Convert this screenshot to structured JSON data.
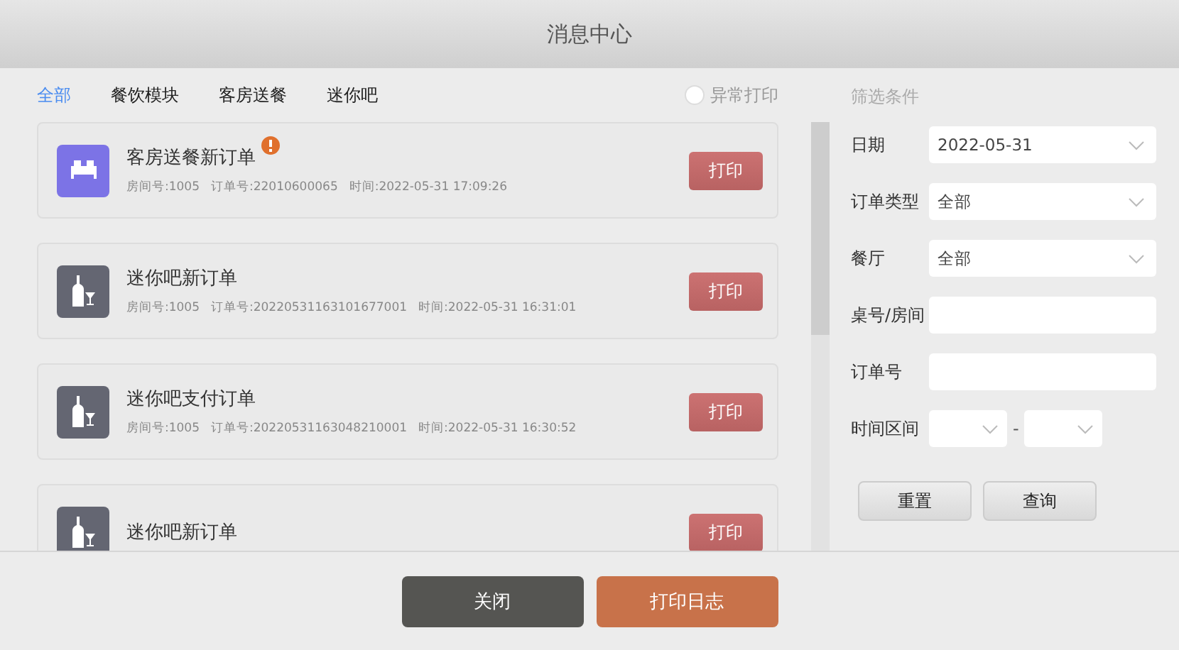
{
  "window": {
    "title": "消息中心"
  },
  "tabs": [
    {
      "label": "全部",
      "selected": true
    },
    {
      "label": "餐饮模块",
      "selected": false
    },
    {
      "label": "客房送餐",
      "selected": false
    },
    {
      "label": "迷你吧",
      "selected": false
    }
  ],
  "abnormal_print": {
    "label": "异常打印",
    "checked": false
  },
  "messages": [
    {
      "kind": "room_service",
      "title": "客房送餐新订单",
      "alert": true,
      "room": "房间号:1005",
      "order": "订单号:22010600065",
      "time": "时间:2022-05-31  17:09:26",
      "button": "打印"
    },
    {
      "kind": "minibar",
      "title": "迷你吧新订单",
      "alert": false,
      "room": "房间号:1005",
      "order": "订单号:20220531163101677001",
      "time": "时间:2022-05-31  16:31:01",
      "button": "打印"
    },
    {
      "kind": "minibar",
      "title": "迷你吧支付订单",
      "alert": false,
      "room": "房间号:1005",
      "order": "订单号:20220531163048210001",
      "time": "时间:2022-05-31  16:30:52",
      "button": "打印"
    },
    {
      "kind": "minibar",
      "title": "迷你吧新订单",
      "alert": false,
      "button": "打印"
    }
  ],
  "filter": {
    "title": "筛选条件",
    "fields": [
      {
        "kind": "select",
        "label": "日期",
        "value": "2022-05-31"
      },
      {
        "kind": "select",
        "label": "订单类型",
        "value": "全部"
      },
      {
        "kind": "select",
        "label": "餐厅",
        "value": "全部"
      },
      {
        "kind": "input",
        "label": "桌号/房间"
      },
      {
        "kind": "input",
        "label": "订单号"
      },
      {
        "kind": "range",
        "label": "时间区间",
        "separator": "-"
      }
    ],
    "buttons": [
      "重置",
      "查询"
    ]
  },
  "footer": {
    "close": "关闭",
    "print_log": "打印日志"
  }
}
